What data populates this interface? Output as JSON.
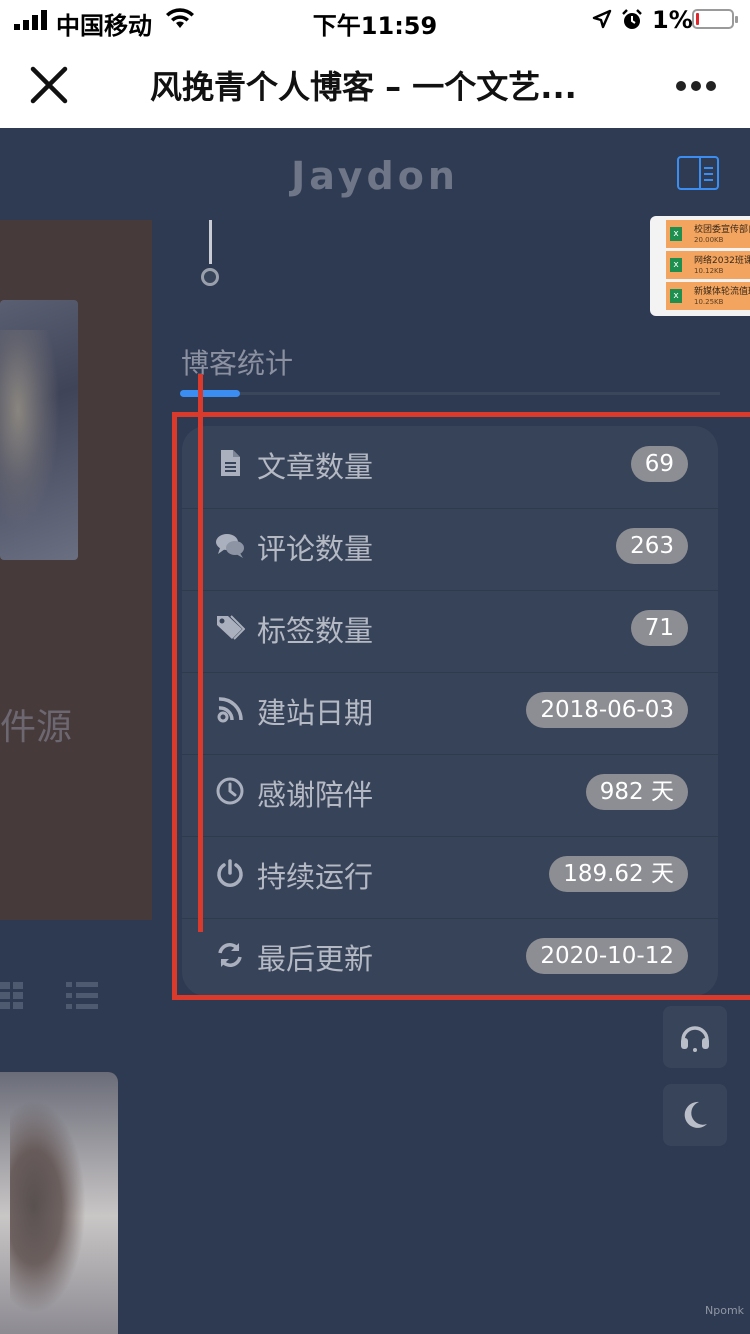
{
  "status_bar": {
    "carrier": "中国移动",
    "time": "下午11:59",
    "battery_percent": "1%"
  },
  "nav": {
    "title": "风挽青个人博客 – 一个文艺..."
  },
  "header": {
    "logo": "Jaydon"
  },
  "sidebar_left": {
    "text": "件源"
  },
  "file_preview": {
    "files": [
      {
        "name": "校团委宣传部自",
        "size": "20.00KB"
      },
      {
        "name": "网络2032班课",
        "size": "10.12KB"
      },
      {
        "name": "新媒体轮流值班",
        "size": "10.25KB"
      }
    ]
  },
  "stats": {
    "title": "博客统计",
    "rows": [
      {
        "label": "文章数量",
        "value": "69",
        "icon": "file-icon"
      },
      {
        "label": "评论数量",
        "value": "263",
        "icon": "comments-icon"
      },
      {
        "label": "标签数量",
        "value": "71",
        "icon": "tags-icon"
      },
      {
        "label": "建站日期",
        "value": "2018-06-03",
        "icon": "rss-icon"
      },
      {
        "label": "感谢陪伴",
        "value": "982 天",
        "icon": "clock-icon"
      },
      {
        "label": "持续运行",
        "value": "189.62 天",
        "icon": "power-icon"
      },
      {
        "label": "最后更新",
        "value": "2020-10-12",
        "icon": "refresh-icon"
      }
    ]
  },
  "watermark": "Npomk",
  "colors": {
    "accent": "#3b8df2",
    "annotation": "#d93a2b",
    "background": "#2e3a52",
    "card": "#374358",
    "badge": "#8d8e93"
  }
}
